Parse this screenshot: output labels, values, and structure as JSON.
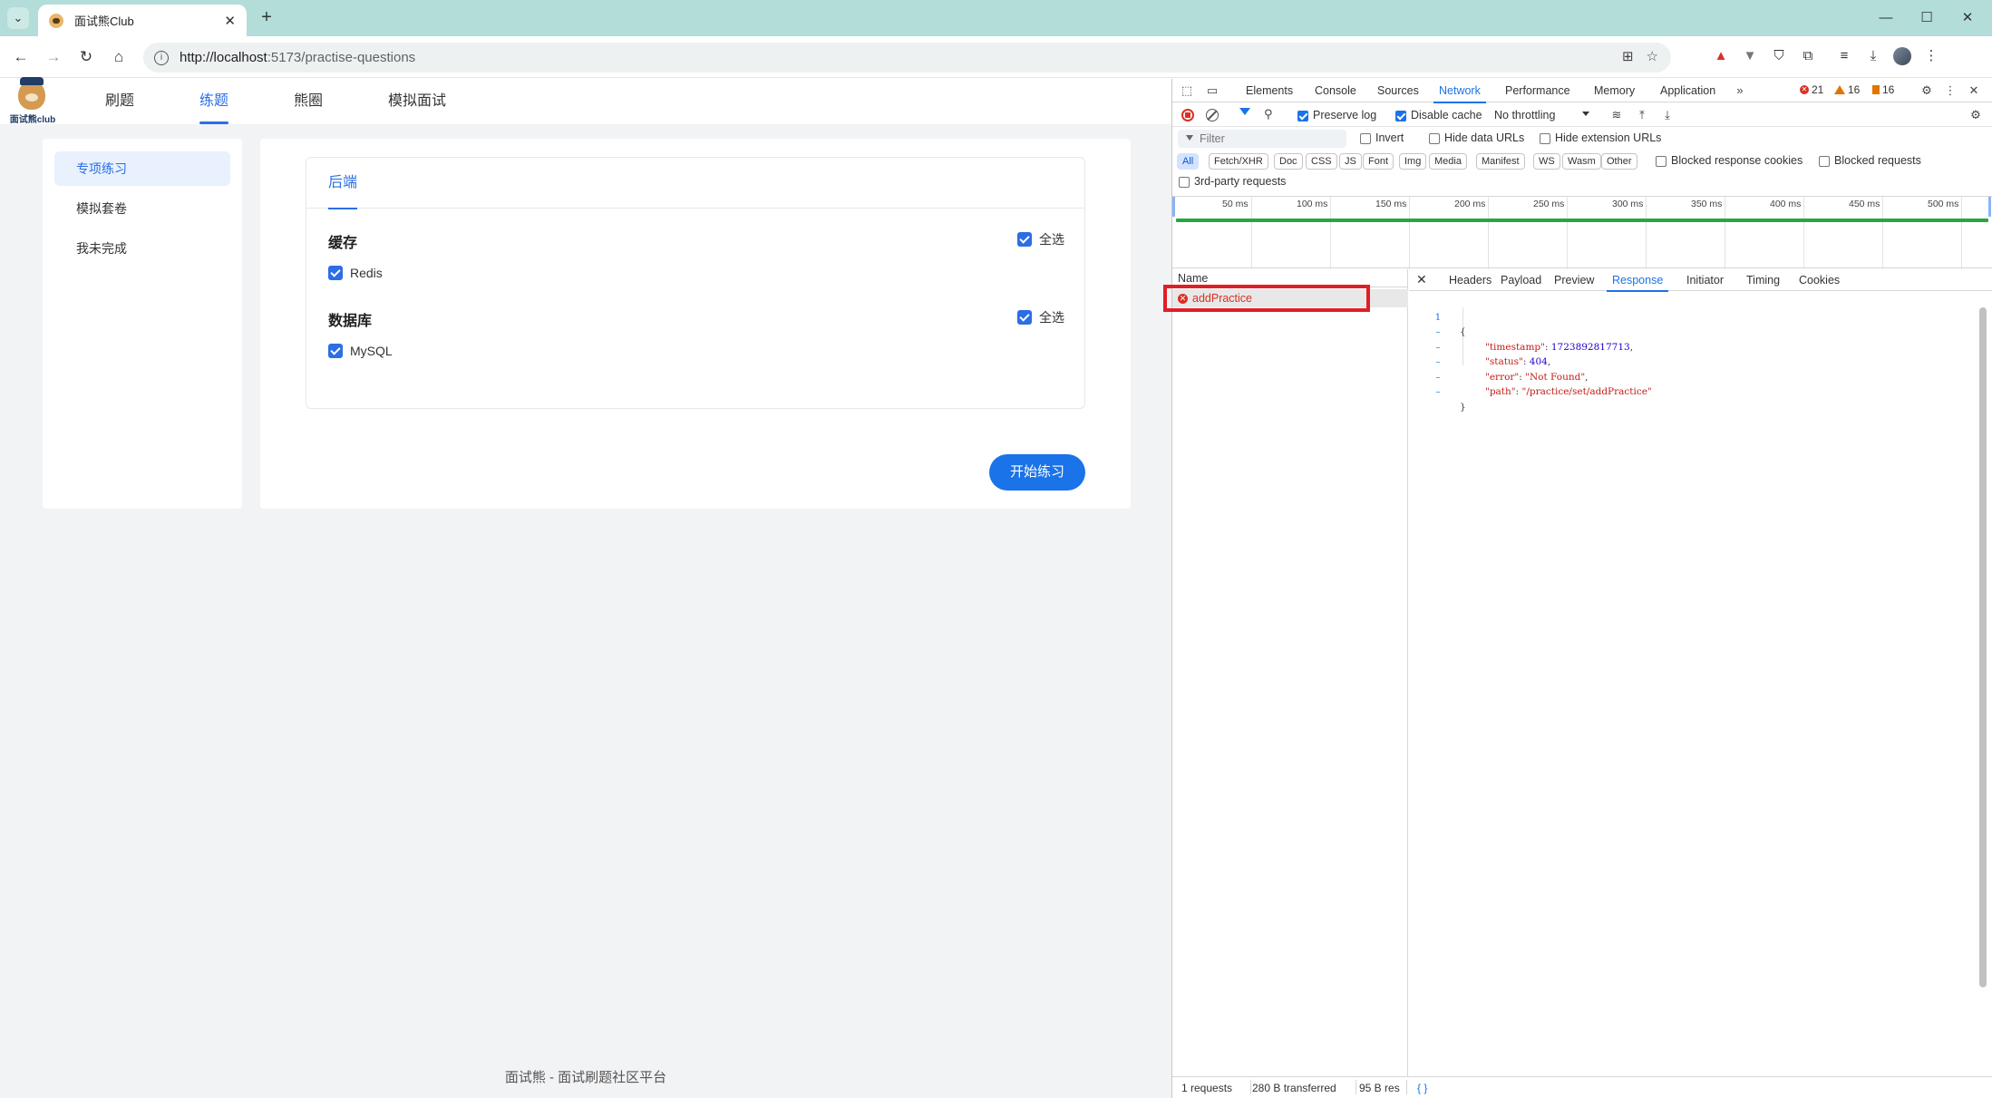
{
  "browser": {
    "tab_title": "面试熊Club",
    "url_host": "http://localhost",
    "url_path": ":5173/practise-questions"
  },
  "site": {
    "logo_text": "面试熊club",
    "nav": [
      "刷题",
      "练题",
      "熊圈",
      "模拟面试"
    ],
    "active_nav": "练题",
    "sidebar": [
      "专项练习",
      "模拟套卷",
      "我未完成"
    ],
    "active_sidebar": "专项练习",
    "inner_tab": "后端",
    "categories": [
      {
        "title": "缓存",
        "select_all": "全选",
        "items": [
          "Redis"
        ]
      },
      {
        "title": "数据库",
        "select_all": "全选",
        "items": [
          "MySQL"
        ]
      }
    ],
    "start_button": "开始练习",
    "footer": "面试熊 - 面试刷题社区平台"
  },
  "devtools": {
    "tabs": [
      "Elements",
      "Console",
      "Sources",
      "Network",
      "Performance",
      "Memory",
      "Application"
    ],
    "active_tab": "Network",
    "errors": "21",
    "warnings": "16",
    "issues": "16",
    "preserve_log": "Preserve log",
    "disable_cache": "Disable cache",
    "throttling": "No throttling",
    "filter_placeholder": "Filter",
    "invert": "Invert",
    "hide_data_urls": "Hide data URLs",
    "hide_extension_urls": "Hide extension URLs",
    "type_filters": [
      "All",
      "Fetch/XHR",
      "Doc",
      "CSS",
      "JS",
      "Font",
      "Img",
      "Media",
      "Manifest",
      "WS",
      "Wasm",
      "Other"
    ],
    "blocked_response_cookies": "Blocked response cookies",
    "blocked_requests": "Blocked requests",
    "third_party": "3rd-party requests",
    "timeline_ticks": [
      "50 ms",
      "100 ms",
      "150 ms",
      "200 ms",
      "250 ms",
      "300 ms",
      "350 ms",
      "400 ms",
      "450 ms",
      "500 ms"
    ],
    "list_header": "Name",
    "request_name": "addPractice",
    "detail_tabs": [
      "Headers",
      "Payload",
      "Preview",
      "Response",
      "Initiator",
      "Timing",
      "Cookies"
    ],
    "active_detail_tab": "Response",
    "response": {
      "line_number": "1",
      "open": "{",
      "close": "}",
      "timestamp_key": "\"timestamp\"",
      "timestamp_val": "1723892817713",
      "status_key": "\"status\"",
      "status_val": "404",
      "error_key": "\"error\"",
      "error_val": "\"Not Found\"",
      "path_key": "\"path\"",
      "path_val": "\"/practice/set/addPractice\""
    },
    "status": {
      "requests": "1 requests",
      "transferred": "280 B transferred",
      "resources": "95 B res",
      "format_icon": "{ }"
    }
  }
}
